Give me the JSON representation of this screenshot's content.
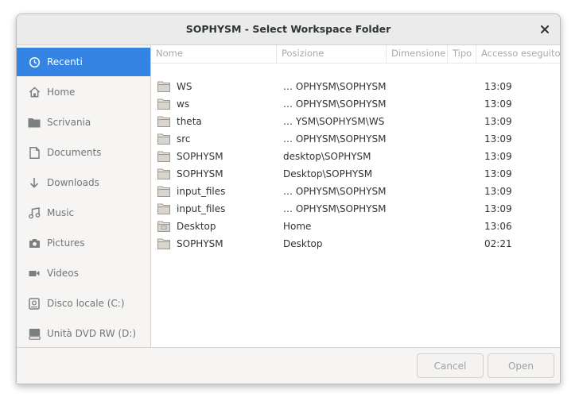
{
  "window": {
    "title": "SOPHYSM - Select Workspace Folder"
  },
  "sidebar": {
    "items": [
      {
        "label": "Recenti",
        "icon": "clock-icon",
        "active": true
      },
      {
        "label": "Home",
        "icon": "home-icon"
      },
      {
        "label": "Scrivania",
        "icon": "folder-icon"
      },
      {
        "label": "Documents",
        "icon": "document-icon"
      },
      {
        "label": "Downloads",
        "icon": "download-icon"
      },
      {
        "label": "Music",
        "icon": "music-icon"
      },
      {
        "label": "Pictures",
        "icon": "camera-icon"
      },
      {
        "label": "Videos",
        "icon": "video-icon"
      },
      {
        "label": "Disco locale (C:)",
        "icon": "drive-icon"
      },
      {
        "label": "Unità DVD RW (D:)",
        "icon": "optical-drive-icon"
      }
    ]
  },
  "filelist": {
    "columns": [
      "Nome",
      "Posizione",
      "Dimensione",
      "Tipo",
      "Accesso eseguito"
    ],
    "rows": [
      {
        "name": "WS",
        "location": "… OPHYSM\\SOPHYSM",
        "time": "13:09",
        "icon": "folder-icon"
      },
      {
        "name": "ws",
        "location": "… OPHYSM\\SOPHYSM",
        "time": "13:09",
        "icon": "folder-icon"
      },
      {
        "name": "theta",
        "location": "… YSM\\SOPHYSM\\WS",
        "time": "13:09",
        "icon": "folder-icon"
      },
      {
        "name": "src",
        "location": "… OPHYSM\\SOPHYSM",
        "time": "13:09",
        "icon": "folder-icon"
      },
      {
        "name": "SOPHYSM",
        "location": "desktop\\SOPHYSM",
        "time": "13:09",
        "icon": "folder-icon"
      },
      {
        "name": "SOPHYSM",
        "location": "Desktop\\SOPHYSM",
        "time": "13:09",
        "icon": "folder-icon"
      },
      {
        "name": "input_files",
        "location": "… OPHYSM\\SOPHYSM",
        "time": "13:09",
        "icon": "folder-icon"
      },
      {
        "name": "input_files",
        "location": "… OPHYSM\\SOPHYSM",
        "time": "13:09",
        "icon": "folder-icon"
      },
      {
        "name": "Desktop",
        "location": "Home",
        "time": "13:06",
        "icon": "desktop-folder-icon"
      },
      {
        "name": "SOPHYSM",
        "location": "Desktop",
        "time": "02:21",
        "icon": "folder-icon"
      }
    ]
  },
  "footer": {
    "cancel_label": "Cancel",
    "open_label": "Open"
  },
  "colors": {
    "accent": "#3584e4",
    "sidebar_bg": "#f6f5f4",
    "titlebar_bg": "#ebebeb"
  }
}
